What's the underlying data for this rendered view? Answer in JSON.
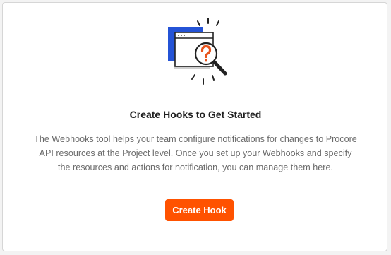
{
  "empty_state": {
    "illustration_icon": "window-magnifier-question-icon",
    "title": "Create Hooks to Get Started",
    "description": "The Webhooks tool helps your team configure notifications for changes to Procore API resources at the Project level. Once you set up your Webhooks and specify the resources and actions for notification, you can manage them here.",
    "button_label": "Create Hook"
  },
  "colors": {
    "accent": "#ff5200",
    "illustration_blue": "#2453d6",
    "question_mark": "#e8541c"
  }
}
